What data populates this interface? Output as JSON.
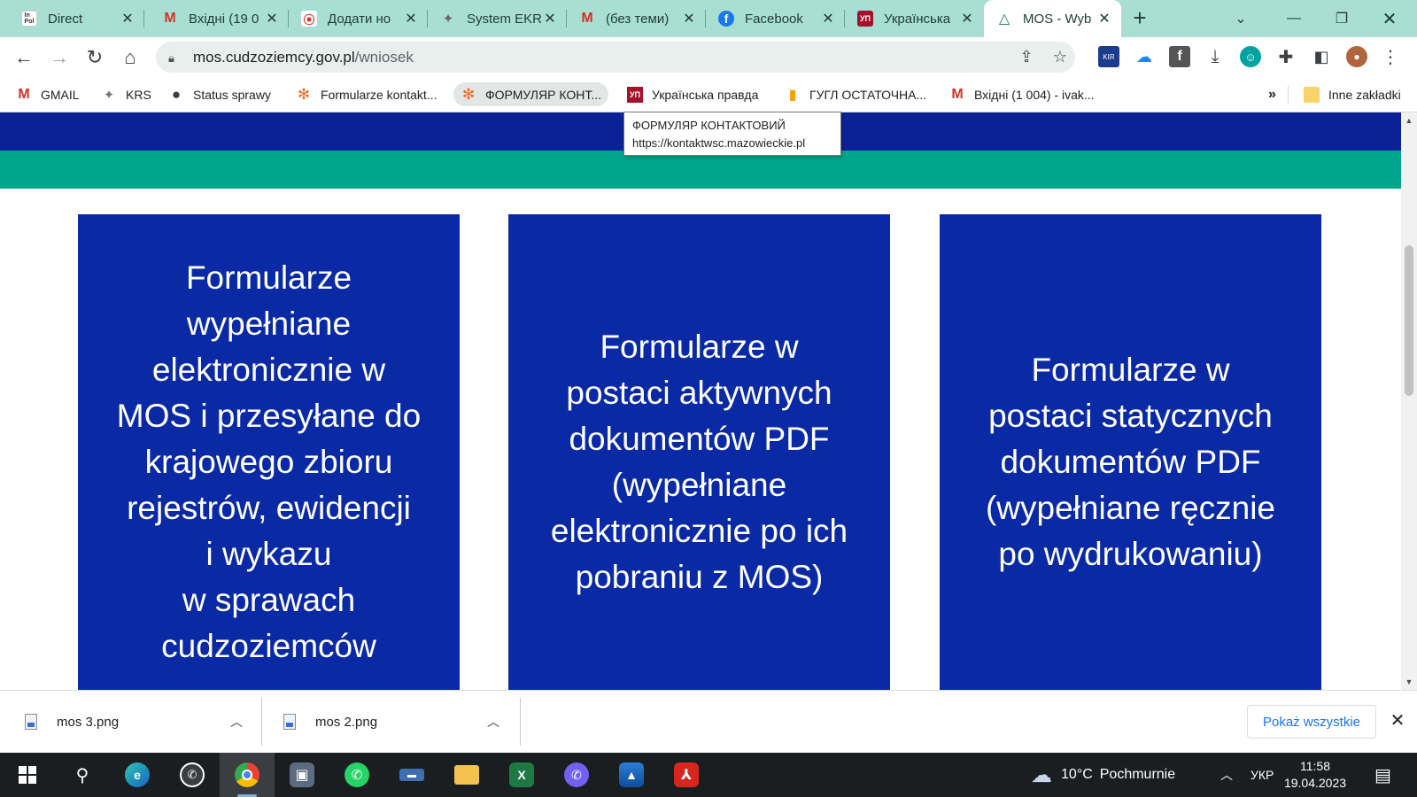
{
  "browser": {
    "tabs": [
      {
        "title": "Direct",
        "favicon": "inpol-icon",
        "fav_text": "In Pol",
        "fav_bg": "#ffffff",
        "fav_fg": "#333333"
      },
      {
        "title": "Вхідні (19 0",
        "favicon": "gmail-icon",
        "fav_text": "M",
        "fav_bg": "transparent",
        "fav_fg": "#d93025"
      },
      {
        "title": "Додати но",
        "favicon": "pin-icon",
        "fav_text": "⦿",
        "fav_bg": "#ffffff",
        "fav_fg": "#d93025"
      },
      {
        "title": "System EKR",
        "favicon": "eagle-icon",
        "fav_text": "✦",
        "fav_bg": "transparent",
        "fav_fg": "#666666"
      },
      {
        "title": "(без теми)",
        "favicon": "gmail-icon",
        "fav_text": "M",
        "fav_bg": "transparent",
        "fav_fg": "#d93025"
      },
      {
        "title": "Facebook",
        "favicon": "facebook-icon",
        "fav_text": "f",
        "fav_bg": "#1877f2",
        "fav_fg": "#ffffff"
      },
      {
        "title": "Українська",
        "favicon": "up-icon",
        "fav_text": "УП",
        "fav_bg": "#a3122a",
        "fav_fg": "#ffffff"
      },
      {
        "title": "MOS - Wyb",
        "favicon": "mos-icon",
        "fav_text": "△",
        "fav_bg": "transparent",
        "fav_fg": "#0b7a61"
      }
    ],
    "new_tab_symbol": "+",
    "address": {
      "domain": "mos.cudzoziemcy.gov.pl",
      "path": "/wniosek"
    },
    "bookmarks": [
      {
        "label": "GMAIL",
        "icon": "gmail-icon",
        "fav_text": "M",
        "fav_fg": "#d93025"
      },
      {
        "label": "KRS",
        "icon": "eagle-icon",
        "fav_text": "✦",
        "fav_fg": "#777777"
      },
      {
        "label": "Status sprawy",
        "icon": "globe-icon",
        "fav_text": "●",
        "fav_fg": "#3c4043"
      },
      {
        "label": "Formularze kontakt...",
        "icon": "joomla-icon",
        "fav_text": "✻",
        "fav_fg": "#f16b2b"
      },
      {
        "label": "ФОРМУЛЯР КОНТ...",
        "icon": "joomla-icon",
        "fav_text": "✻",
        "fav_fg": "#f16b2b"
      },
      {
        "label": "Українська правда",
        "icon": "up-icon",
        "fav_text": "УП",
        "fav_fg": "#a3122a"
      },
      {
        "label": "ГУГЛ ОСТАТОЧНА...",
        "icon": "analytics-icon",
        "fav_text": "▮",
        "fav_fg": "#f4a300"
      },
      {
        "label": "Вхідні (1 004) - ivak...",
        "icon": "gmail-icon",
        "fav_text": "M",
        "fav_fg": "#d93025"
      }
    ],
    "bookmarks_overflow": "»",
    "other_bookmarks": "Inne zakładki",
    "tooltip": {
      "title": "ФОРМУЛЯР КОНТАКТОВИЙ",
      "url": "https://kontaktwsc.mazowieckie.pl"
    }
  },
  "page": {
    "cards": [
      {
        "lines": [
          "Formularze",
          "wypełniane",
          "elektronicznie w",
          "MOS i przesyłane do",
          "krajowego zbioru",
          "rejestrów, ewidencji",
          "i wykazu",
          "w sprawach",
          "cudzoziemców"
        ]
      },
      {
        "lines": [
          "Formularze w",
          "postaci aktywnych",
          "dokumentów PDF",
          "(wypełniane",
          "elektronicznie po ich",
          "pobraniu z MOS)"
        ]
      },
      {
        "lines": [
          "Formularze w",
          "postaci statycznych",
          "dokumentów PDF",
          "(wypełniane ręcznie",
          "po wydrukowaniu)"
        ]
      }
    ],
    "colors": {
      "header_blue": "#0b2196",
      "teal_band": "#00a68c",
      "card_blue": "#0a2aa5"
    }
  },
  "downloads": {
    "items": [
      {
        "name": "mos 3.png"
      },
      {
        "name": "mos 2.png"
      }
    ],
    "show_all": "Pokaż wszystkie"
  },
  "taskbar": {
    "apps": [
      "start-icon",
      "search-icon",
      "edge-icon",
      "whatsapp-icon",
      "chrome-icon",
      "computer-icon",
      "whatsapp-icon",
      "scanner-icon",
      "file-explorer-icon",
      "excel-icon",
      "viber-icon",
      "photos-icon",
      "acrobat-icon"
    ],
    "weather": {
      "temp": "10°C",
      "desc": "Pochmurnie"
    },
    "language": "УКР",
    "time": "11:58",
    "date": "19.04.2023"
  }
}
